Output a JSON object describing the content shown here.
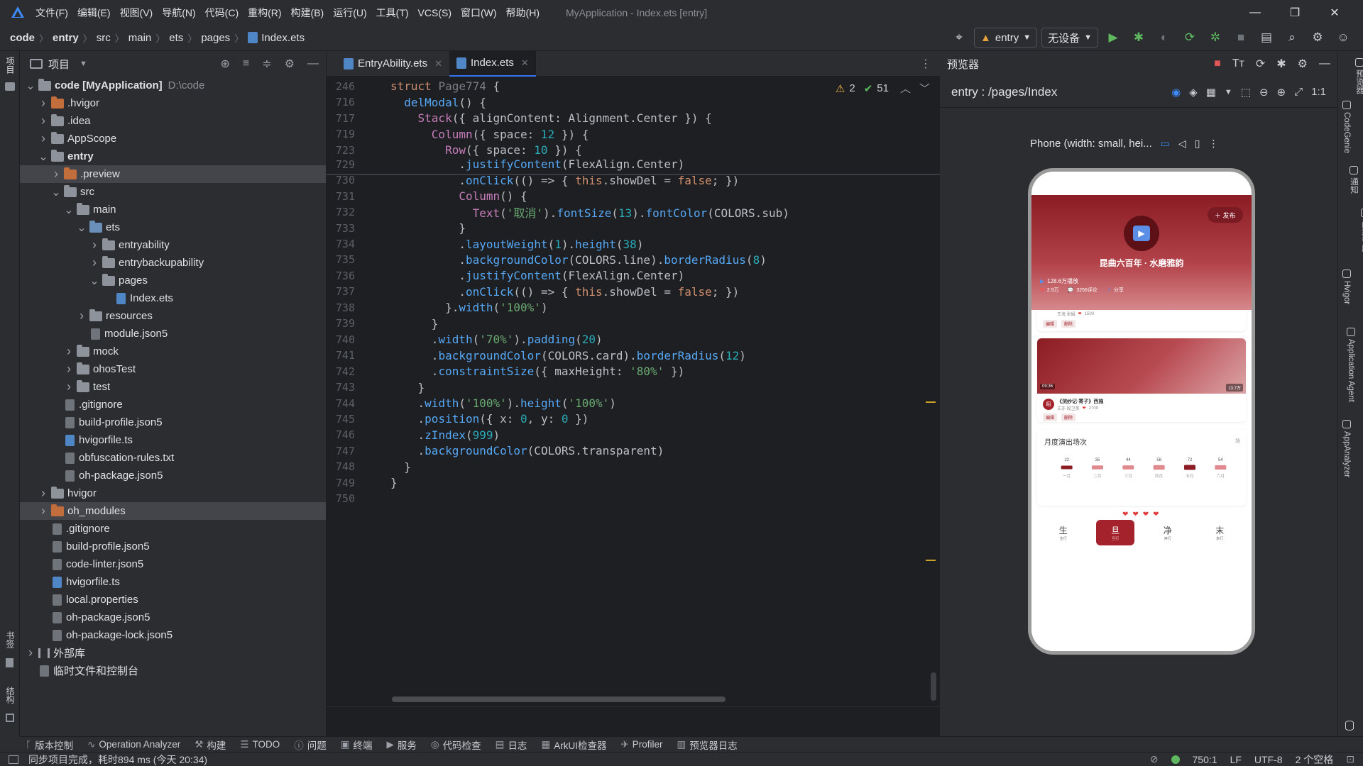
{
  "menubar": {
    "items": [
      "文件(F)",
      "编辑(E)",
      "视图(V)",
      "导航(N)",
      "代码(C)",
      "重构(R)",
      "构建(B)",
      "运行(U)",
      "工具(T)",
      "VCS(S)",
      "窗口(W)",
      "帮助(H)"
    ],
    "window_title": "MyApplication - Index.ets [entry]"
  },
  "breadcrumb": [
    "code",
    "entry",
    "src",
    "main",
    "ets",
    "pages",
    "Index.ets"
  ],
  "toolbar": {
    "module": "entry",
    "device": "无设备"
  },
  "project": {
    "title": "项目",
    "tree": [
      {
        "label": "code [MyApplication]",
        "extra": "D:\\code",
        "depth": 0,
        "chev": "v",
        "icon": "folder"
      },
      {
        "label": ".hvigor",
        "depth": 1,
        "chev": ">",
        "icon": "folder-orange"
      },
      {
        "label": ".idea",
        "depth": 1,
        "chev": ">",
        "icon": "folder"
      },
      {
        "label": "AppScope",
        "depth": 1,
        "chev": ">",
        "icon": "folder"
      },
      {
        "label": "entry",
        "depth": 1,
        "chev": "v",
        "icon": "folder"
      },
      {
        "label": ".preview",
        "depth": 2,
        "chev": ">",
        "icon": "folder-orange",
        "selected": true
      },
      {
        "label": "src",
        "depth": 2,
        "chev": "v",
        "icon": "folder"
      },
      {
        "label": "main",
        "depth": 3,
        "chev": "v",
        "icon": "folder"
      },
      {
        "label": "ets",
        "depth": 4,
        "chev": "v",
        "icon": "folder-blue"
      },
      {
        "label": "entryability",
        "depth": 5,
        "chev": ">",
        "icon": "folder"
      },
      {
        "label": "entrybackupability",
        "depth": 5,
        "chev": ">",
        "icon": "folder"
      },
      {
        "label": "pages",
        "depth": 5,
        "chev": "v",
        "icon": "folder"
      },
      {
        "label": "Index.ets",
        "depth": 6,
        "chev": "",
        "icon": "file-ts"
      },
      {
        "label": "resources",
        "depth": 4,
        "chev": ">",
        "icon": "folder"
      },
      {
        "label": "module.json5",
        "depth": 4,
        "chev": "",
        "icon": "file"
      },
      {
        "label": "mock",
        "depth": 3,
        "chev": ">",
        "icon": "folder"
      },
      {
        "label": "ohosTest",
        "depth": 3,
        "chev": ">",
        "icon": "folder"
      },
      {
        "label": "test",
        "depth": 3,
        "chev": ">",
        "icon": "folder"
      },
      {
        "label": ".gitignore",
        "depth": 2,
        "chev": "",
        "icon": "file"
      },
      {
        "label": "build-profile.json5",
        "depth": 2,
        "chev": "",
        "icon": "file"
      },
      {
        "label": "hvigorfile.ts",
        "depth": 2,
        "chev": "",
        "icon": "file-ts"
      },
      {
        "label": "obfuscation-rules.txt",
        "depth": 2,
        "chev": "",
        "icon": "file"
      },
      {
        "label": "oh-package.json5",
        "depth": 2,
        "chev": "",
        "icon": "file"
      },
      {
        "label": "hvigor",
        "depth": 1,
        "chev": ">",
        "icon": "folder"
      },
      {
        "label": "oh_modules",
        "depth": 1,
        "chev": ">",
        "icon": "folder-orange",
        "selected": true
      },
      {
        "label": ".gitignore",
        "depth": 1,
        "chev": "",
        "icon": "file"
      },
      {
        "label": "build-profile.json5",
        "depth": 1,
        "chev": "",
        "icon": "file"
      },
      {
        "label": "code-linter.json5",
        "depth": 1,
        "chev": "",
        "icon": "file"
      },
      {
        "label": "hvigorfile.ts",
        "depth": 1,
        "chev": "",
        "icon": "file-ts"
      },
      {
        "label": "local.properties",
        "depth": 1,
        "chev": "",
        "icon": "file"
      },
      {
        "label": "oh-package.json5",
        "depth": 1,
        "chev": "",
        "icon": "file"
      },
      {
        "label": "oh-package-lock.json5",
        "depth": 1,
        "chev": "",
        "icon": "file"
      },
      {
        "label": "外部库",
        "depth": 0,
        "chev": ">",
        "icon": "libs"
      },
      {
        "label": "临时文件和控制台",
        "depth": 0,
        "chev": "",
        "icon": "file"
      }
    ]
  },
  "editor": {
    "tabs": [
      {
        "label": "EntryAbility.ets"
      },
      {
        "label": "Index.ets"
      }
    ],
    "inspection": {
      "warnings": "2",
      "ok": "51"
    },
    "lines": [
      {
        "n": "246",
        "html": "<span class='kw'>struct</span> <span class='gray'>Page774</span> {"
      },
      {
        "n": "716",
        "html": "  <span class='fn'>delModal</span>() {"
      },
      {
        "n": "717",
        "html": "    <span class='comp'>Stack</span>({ alignContent: <span class='plain'>Alignment</span>.Center }) {"
      },
      {
        "n": "719",
        "html": "      <span class='comp'>Column</span>({ space: <span class='num'>12</span> }) {"
      },
      {
        "n": "723",
        "html": "        <span class='comp'>Row</span>({ space: <span class='num'>10</span> }) {"
      },
      {
        "n": "729",
        "html": "          .<span class='fn'>justifyContent</span>(FlexAlign.Center)"
      },
      {
        "n": "730",
        "html": "          .<span class='fn'>onClick</span>(() => { <span class='kw'>this</span>.showDel = <span class='kw'>false</span>; })"
      },
      {
        "n": "731",
        "html": "          <span class='comp'>Column</span>() {"
      },
      {
        "n": "732",
        "html": "            <span class='comp'>Text</span>(<span class='str'>'取消'</span>).<span class='fn'>fontSize</span>(<span class='num'>13</span>).<span class='fn'>fontColor</span>(COLORS.sub)"
      },
      {
        "n": "733",
        "html": "          }"
      },
      {
        "n": "734",
        "html": "          .<span class='fn'>layoutWeight</span>(<span class='num'>1</span>).<span class='fn'>height</span>(<span class='num'>38</span>)"
      },
      {
        "n": "735",
        "html": "          .<span class='fn'>backgroundColor</span>(COLORS.line).<span class='fn'>borderRadius</span>(<span class='num'>8</span>)"
      },
      {
        "n": "736",
        "html": "          .<span class='fn'>justifyContent</span>(FlexAlign.Center)"
      },
      {
        "n": "737",
        "html": "          .<span class='fn'>onClick</span>(() => { <span class='kw'>this</span>.showDel = <span class='kw'>false</span>; })"
      },
      {
        "n": "738",
        "html": "        }.<span class='fn'>width</span>(<span class='str'>'100%'</span>)"
      },
      {
        "n": "739",
        "html": "      }"
      },
      {
        "n": "740",
        "html": "      .<span class='fn'>width</span>(<span class='str'>'70%'</span>).<span class='fn'>padding</span>(<span class='num'>20</span>)"
      },
      {
        "n": "741",
        "html": "      .<span class='fn'>backgroundColor</span>(COLORS.card).<span class='fn'>borderRadius</span>(<span class='num'>12</span>)"
      },
      {
        "n": "742",
        "html": "      .<span class='fn'>constraintSize</span>({ maxHeight: <span class='str'>'80%'</span> })"
      },
      {
        "n": "743",
        "html": "    }"
      },
      {
        "n": "744",
        "html": "    .<span class='fn'>width</span>(<span class='str'>'100%'</span>).<span class='fn'>height</span>(<span class='str'>'100%'</span>)"
      },
      {
        "n": "745",
        "html": "    .<span class='fn'>position</span>({ x: <span class='num'>0</span>, y: <span class='num'>0</span> })"
      },
      {
        "n": "746",
        "html": "    .<span class='fn'>zIndex</span>(<span class='num'>999</span>)"
      },
      {
        "n": "747",
        "html": "    .<span class='fn'>backgroundColor</span>(COLORS.transparent)"
      },
      {
        "n": "748",
        "html": "  }"
      },
      {
        "n": "749",
        "html": "}"
      },
      {
        "n": "750",
        "html": ""
      }
    ]
  },
  "preview": {
    "title": "预览器",
    "path": "entry : /pages/Index",
    "device_label": "Phone (width: small, hei...",
    "app": {
      "publish": "＋ 发布",
      "hero_title": "昆曲六百年 · 水磨雅韵",
      "plays": "128.6万播放",
      "likes": "2.9万",
      "comments": "3256评论",
      "share": "分享",
      "card1_user": "王海 张娟",
      "card1_likes": "1500",
      "card1_tags": [
        "编辑",
        "删除"
      ],
      "video_time": "09:36",
      "video_views": "13.7万",
      "card2_avatar": "昭",
      "card2_title": "《浣纱记·寄子》西施",
      "card2_user": "王亦 段卫英",
      "card2_likes": "2700",
      "card2_tags": [
        "编辑",
        "删除"
      ],
      "chart_title": "月度演出场次",
      "chart_corner": "场",
      "nav": [
        {
          "label": "生",
          "sub": "生行"
        },
        {
          "label": "旦",
          "sub": "旦行"
        },
        {
          "label": "净",
          "sub": "净行"
        },
        {
          "label": "末",
          "sub": "末行"
        }
      ]
    }
  },
  "chart_data": {
    "type": "bar",
    "title": "月度演出场次",
    "categories": [
      "一月",
      "二月",
      "三月",
      "四月",
      "五月",
      "六月"
    ],
    "values": [
      22,
      35,
      44,
      58,
      72,
      54
    ],
    "highlight": [
      0,
      4
    ]
  },
  "tool_tabs": [
    "版本控制",
    "Operation Analyzer",
    "构建",
    "TODO",
    "问题",
    "终端",
    "服务",
    "代码检查",
    "日志",
    "ArkUI检查器",
    "Profiler",
    "预览器日志"
  ],
  "statusbar": {
    "message": "同步项目完成，耗时894 ms (今天 20:34)",
    "position": "750:1",
    "line_sep": "LF",
    "encoding": "UTF-8",
    "indent": "2 个空格"
  },
  "left_strip": {
    "top": "项目",
    "mid": "书签",
    "bottom": "结构"
  },
  "right_strip": [
    "预览器",
    "CodeGenie",
    "通知",
    "问题帮助",
    "Hvigor",
    "Application Agent",
    "AppAnalyzer",
    "设备文件浏览器"
  ],
  "colors": {
    "accent": "#3574f0",
    "brand_red": "#a3222c",
    "editor_bg": "#1e1f22"
  }
}
